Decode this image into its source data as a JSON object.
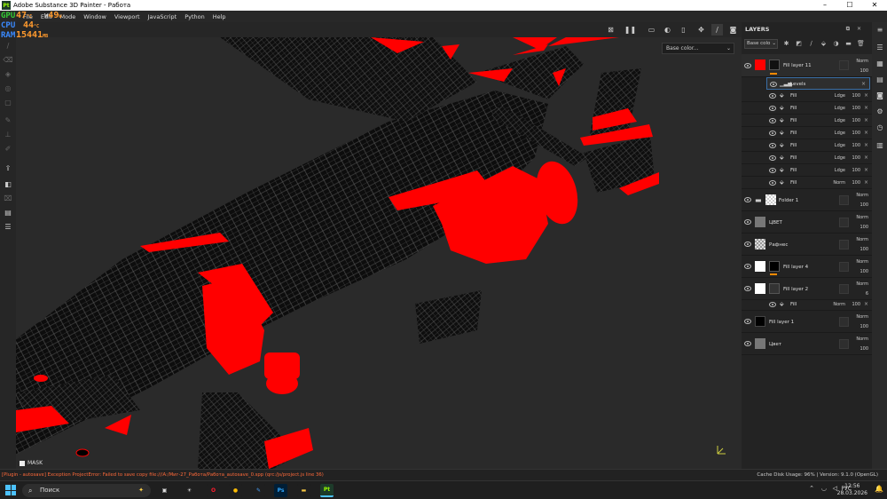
{
  "window": {
    "title": "Adobe Substance 3D Painter - Работа",
    "logo": "Pt",
    "min": "–",
    "max": "☐",
    "close": "✕"
  },
  "menu": [
    "File",
    "Edit",
    "Mode",
    "Window",
    "Viewport",
    "JavaScript",
    "Python",
    "Help"
  ],
  "stats": [
    {
      "key": "GPU",
      "value": "47",
      "unit": "°C",
      "color": "#3c3"
    },
    {
      "key": "CPU",
      "value": "44",
      "unit": "°C",
      "color": "#3a8aff"
    },
    {
      "key": "RAM",
      "value": "15441",
      "unit": "MB",
      "color": "#3a8aff"
    }
  ],
  "stats_w": {
    "key": "W",
    "value": "49",
    "unit": "W"
  },
  "viewport": {
    "channel": "Base color...",
    "mask_label": "MASK"
  },
  "layers_panel": {
    "title": "LAYERS",
    "channel_select": "Base colo",
    "layers": [
      {
        "name": "Fill layer 11",
        "blend": "Norm",
        "opacity": "100",
        "thumb": "#ff0000",
        "type": "fill",
        "selected": true,
        "effects": [
          {
            "name": "Levels",
            "blend": "",
            "opacity": "",
            "kind": "levels"
          },
          {
            "name": "Fill",
            "blend": "Ldge",
            "opacity": "100",
            "kind": "fill"
          },
          {
            "name": "Fill",
            "blend": "Ldge",
            "opacity": "100",
            "kind": "fill"
          },
          {
            "name": "Fill",
            "blend": "Ldge",
            "opacity": "100",
            "kind": "fill"
          },
          {
            "name": "Fill",
            "blend": "Ldge",
            "opacity": "100",
            "kind": "fill"
          },
          {
            "name": "Fill",
            "blend": "Ldge",
            "opacity": "100",
            "kind": "fill"
          },
          {
            "name": "Fill",
            "blend": "Ldge",
            "opacity": "100",
            "kind": "fill"
          },
          {
            "name": "Fill",
            "blend": "Ldge",
            "opacity": "100",
            "kind": "fill"
          },
          {
            "name": "Fill",
            "blend": "Norm",
            "opacity": "100",
            "kind": "fill"
          }
        ]
      },
      {
        "name": "Folder 1",
        "blend": "Norm",
        "opacity": "100",
        "type": "folder"
      },
      {
        "name": "ЦВЕТ",
        "blend": "Norm",
        "opacity": "100",
        "type": "paint"
      },
      {
        "name": "Рафнес",
        "blend": "Norm",
        "opacity": "100",
        "type": "checker"
      },
      {
        "name": "Fill layer 4",
        "blend": "Norm",
        "opacity": "100",
        "thumb": "#ffffff",
        "mask": "#000000",
        "type": "fill"
      },
      {
        "name": "Fill layer 2",
        "blend": "Norm",
        "opacity": "6",
        "thumb": "#ffffff",
        "type": "fill",
        "effects": [
          {
            "name": "Fill",
            "blend": "Norm",
            "opacity": "100",
            "kind": "fill"
          }
        ]
      },
      {
        "name": "Fill layer 1",
        "blend": "Norm",
        "opacity": "100",
        "thumb": "#000000",
        "type": "fill"
      },
      {
        "name": "Цвет",
        "blend": "Norm",
        "opacity": "100",
        "type": "paint"
      }
    ]
  },
  "status": {
    "error": "[Plugin - autosave] Exception ProjectError: Failed to save copy file:///A:/Миг-27_Работа/Работа_autosave_0.spp (qrc:/js/project.js line 36)",
    "info": "Cache Disk Usage:  96% | Version: 9.1.0 (OpenGL)"
  },
  "taskbar": {
    "search_placeholder": "Поиск",
    "lang": "РУС",
    "time": "12:56",
    "date": "28.03.2026",
    "apps": [
      {
        "name": "opera-icon",
        "label": "O",
        "bg": "#1f1f1f",
        "fg": "#ff1b2d"
      },
      {
        "name": "chrome-icon",
        "label": "●",
        "bg": "#1f1f1f",
        "fg": "#fbbc04"
      },
      {
        "name": "edit-app-icon",
        "label": "✎",
        "bg": "#1f1f1f",
        "fg": "#4aa3ff"
      },
      {
        "name": "photoshop-icon",
        "label": "Ps",
        "bg": "#001e36",
        "fg": "#31a8ff"
      },
      {
        "name": "explorer-icon",
        "label": "▬",
        "bg": "#1f1f1f",
        "fg": "#f5c542"
      },
      {
        "name": "painter-icon",
        "label": "Pt",
        "bg": "#1d3b2a",
        "fg": "#9f0"
      }
    ]
  }
}
